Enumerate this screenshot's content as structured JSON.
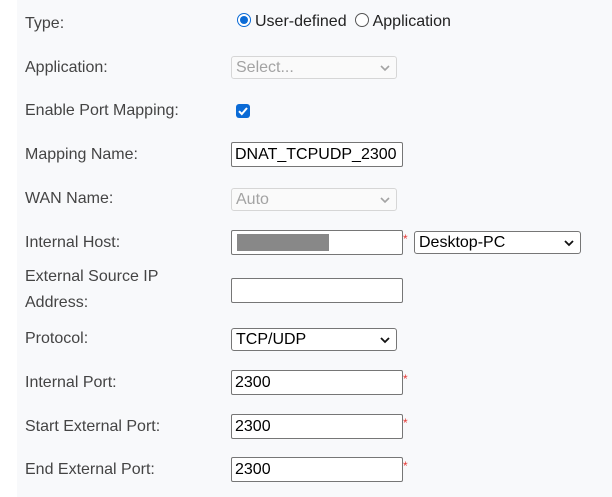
{
  "form": {
    "type": {
      "label": "Type:",
      "options": [
        "User-defined",
        "Application"
      ],
      "selected": "User-defined"
    },
    "application": {
      "label": "Application:",
      "placeholder": "Select..."
    },
    "enable_port_mapping": {
      "label": "Enable Port Mapping:",
      "checked": true
    },
    "mapping_name": {
      "label": "Mapping Name:",
      "value": "DNAT_TCPUDP_2300"
    },
    "wan_name": {
      "label": "WAN Name:",
      "value": "Auto"
    },
    "internal_host": {
      "label": "Internal Host:",
      "required_mark": "*",
      "device": "Desktop-PC"
    },
    "external_source_ip": {
      "label_line1": "External Source IP",
      "label_line2": "Address:",
      "value": ""
    },
    "protocol": {
      "label": "Protocol:",
      "value": "TCP/UDP"
    },
    "internal_port": {
      "label": "Internal Port:",
      "value": "2300",
      "required_mark": "*"
    },
    "start_external_port": {
      "label": "Start External Port:",
      "value": "2300",
      "required_mark": "*"
    },
    "end_external_port": {
      "label": "End External Port:",
      "value": "2300",
      "required_mark": "*"
    }
  },
  "colors": {
    "accent": "#0b6bd6",
    "required": "#e53935",
    "panel_bg": "#f8f9fb",
    "label_text": "#444444"
  }
}
